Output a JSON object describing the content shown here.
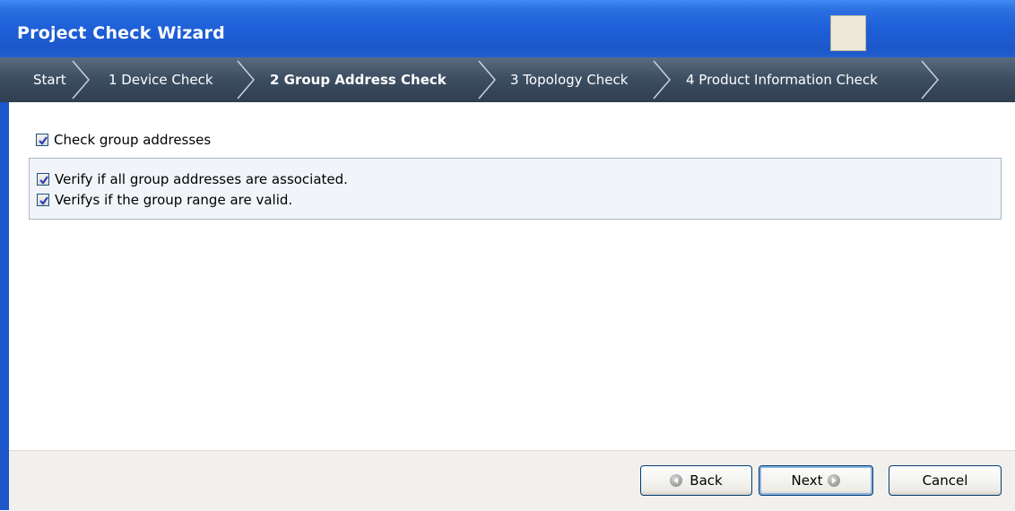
{
  "window": {
    "title": "Project Check Wizard"
  },
  "steps": [
    {
      "label": "Start",
      "active": false
    },
    {
      "label": "1 Device Check",
      "active": false
    },
    {
      "label": "2 Group Address Check",
      "active": true
    },
    {
      "label": "3 Topology Check",
      "active": false
    },
    {
      "label": "4 Product Information Check",
      "active": false
    }
  ],
  "options": {
    "main": {
      "label": "Check group addresses",
      "checked": true
    },
    "sub": [
      {
        "label": "Verify if all group addresses are associated.",
        "checked": true
      },
      {
        "label": "Verifys if the group range are valid.",
        "checked": true
      }
    ]
  },
  "buttons": {
    "back": "Back",
    "next": "Next",
    "cancel": "Cancel"
  },
  "colors": {
    "title_bar": "#1e5fd8",
    "steps_bar": "#3e4f63",
    "footer": "#f2f0ec",
    "checkmark": "#2b3fbf"
  }
}
